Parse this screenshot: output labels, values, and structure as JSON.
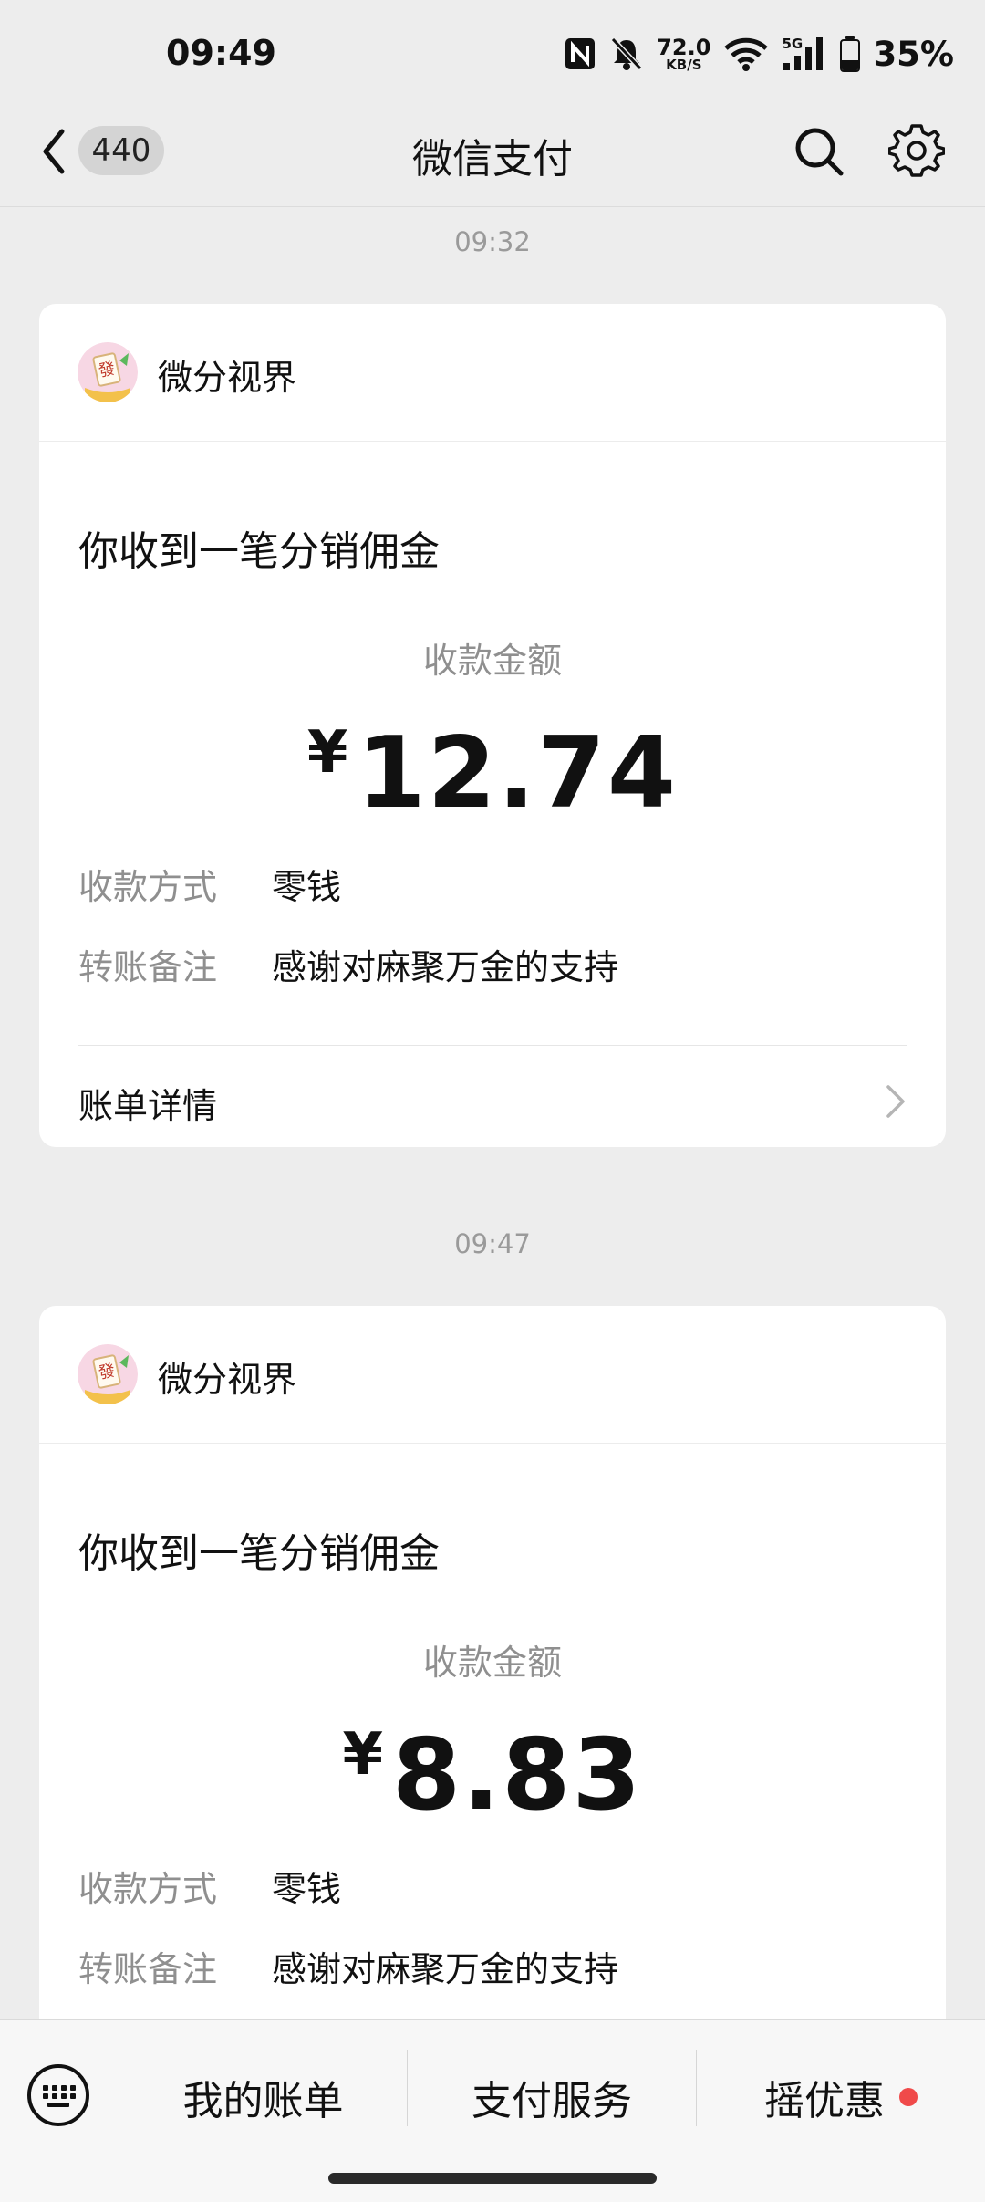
{
  "status_bar": {
    "time": "09:49",
    "net_speed_value": "72.0",
    "net_speed_unit": "KB/S",
    "signal_label": "5G",
    "battery_percent": "35%",
    "battery_level": 0.35,
    "icons": [
      "nfc-icon",
      "bell-muted-icon",
      "wifi-icon",
      "signal-icon",
      "battery-icon"
    ]
  },
  "nav": {
    "unread_count": "440",
    "title": "微信支付",
    "icons": [
      "back-chevron-icon",
      "search-icon",
      "gear-icon"
    ]
  },
  "messages": [
    {
      "timestamp": "09:32",
      "sender": "微分视界",
      "title": "你收到一笔分销佣金",
      "amount_label": "收款金额",
      "currency": "¥",
      "amount": "12.74",
      "method_label": "收款方式",
      "method_value": "零钱",
      "note_label": "转账备注",
      "note_value": "感谢对麻聚万金的支持",
      "detail_label": "账单详情"
    },
    {
      "timestamp": "09:47",
      "sender": "微分视界",
      "title": "你收到一笔分销佣金",
      "amount_label": "收款金额",
      "currency": "¥",
      "amount": "8.83",
      "method_label": "收款方式",
      "method_value": "零钱",
      "note_label": "转账备注",
      "note_value": "感谢对麻聚万金的支持"
    }
  ],
  "bottom_menu": {
    "keyboard_icon": "keyboard-icon",
    "items": [
      "我的账单",
      "支付服务",
      "摇优惠"
    ],
    "dot_color": "#f04a4a"
  },
  "colors": {
    "background": "#ededed",
    "card": "#ffffff",
    "muted_text": "#8f8f8f"
  }
}
